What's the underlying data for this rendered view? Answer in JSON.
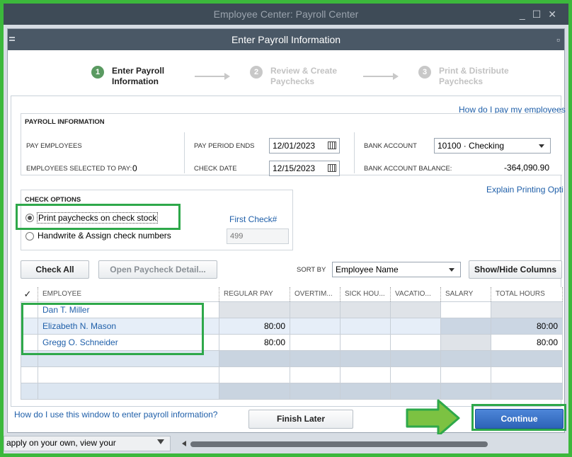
{
  "window": {
    "background_title": "Employee Center: Payroll Center",
    "dialog_title": "Enter Payroll Information"
  },
  "steps": [
    {
      "num": "1",
      "line1": "Enter Payroll",
      "line2": "Information",
      "active": true
    },
    {
      "num": "2",
      "line1": "Review & Create",
      "line2": "Paychecks",
      "active": false
    },
    {
      "num": "3",
      "line1": "Print & Distribute",
      "line2": "Paychecks",
      "active": false
    }
  ],
  "payroll_info": {
    "section_title": "PAYROLL INFORMATION",
    "help_link": "How do I pay my employees",
    "pay_employees_label": "PAY EMPLOYEES",
    "selected_label": "EMPLOYEES SELECTED TO PAY:",
    "selected_count": "0",
    "period_ends_label": "PAY PERIOD ENDS",
    "period_ends_value": "12/01/2023",
    "check_date_label": "CHECK DATE",
    "check_date_value": "12/15/2023",
    "bank_account_label": "BANK ACCOUNT",
    "bank_account_value": "10100 · Checking",
    "balance_label": "BANK ACCOUNT BALANCE:",
    "balance_value": "-364,090.90"
  },
  "check_options": {
    "explain_link": "Explain Printing Opti",
    "section_title": "CHECK OPTIONS",
    "option_print": "Print paychecks on check stock",
    "option_handwrite": "Handwrite & Assign check numbers",
    "first_check_label": "First Check#",
    "first_check_placeholder": "499"
  },
  "toolbar": {
    "check_all": "Check All",
    "open_detail": "Open Paycheck Detail...",
    "sort_by_label": "SORT BY",
    "sort_by_value": "Employee Name",
    "show_hide": "Show/Hide Columns"
  },
  "table": {
    "check_header": "✓",
    "headers": [
      "EMPLOYEE",
      "REGULAR PAY",
      "OVERTIM...",
      "SICK HOU...",
      "VACATIO...",
      "SALARY",
      "TOTAL HOURS"
    ],
    "rows": [
      {
        "name": "Dan T. Miller",
        "regular": "",
        "total": ""
      },
      {
        "name": "Elizabeth N. Mason",
        "regular": "80:00",
        "total": "80:00"
      },
      {
        "name": "Gregg O. Schneider",
        "regular": "80:00",
        "total": "80:00"
      }
    ]
  },
  "bottom": {
    "help_link": "How do I use this window to enter payroll information?",
    "finish_later": "Finish Later",
    "continue": "Continue"
  },
  "statusbar": {
    "text": "apply on your own, view your"
  },
  "colors": {
    "highlight_green": "#2ea84a",
    "arrow_green": "#7cc242",
    "link_blue": "#1f5fa9",
    "continue_blue": "#2d63b8"
  }
}
